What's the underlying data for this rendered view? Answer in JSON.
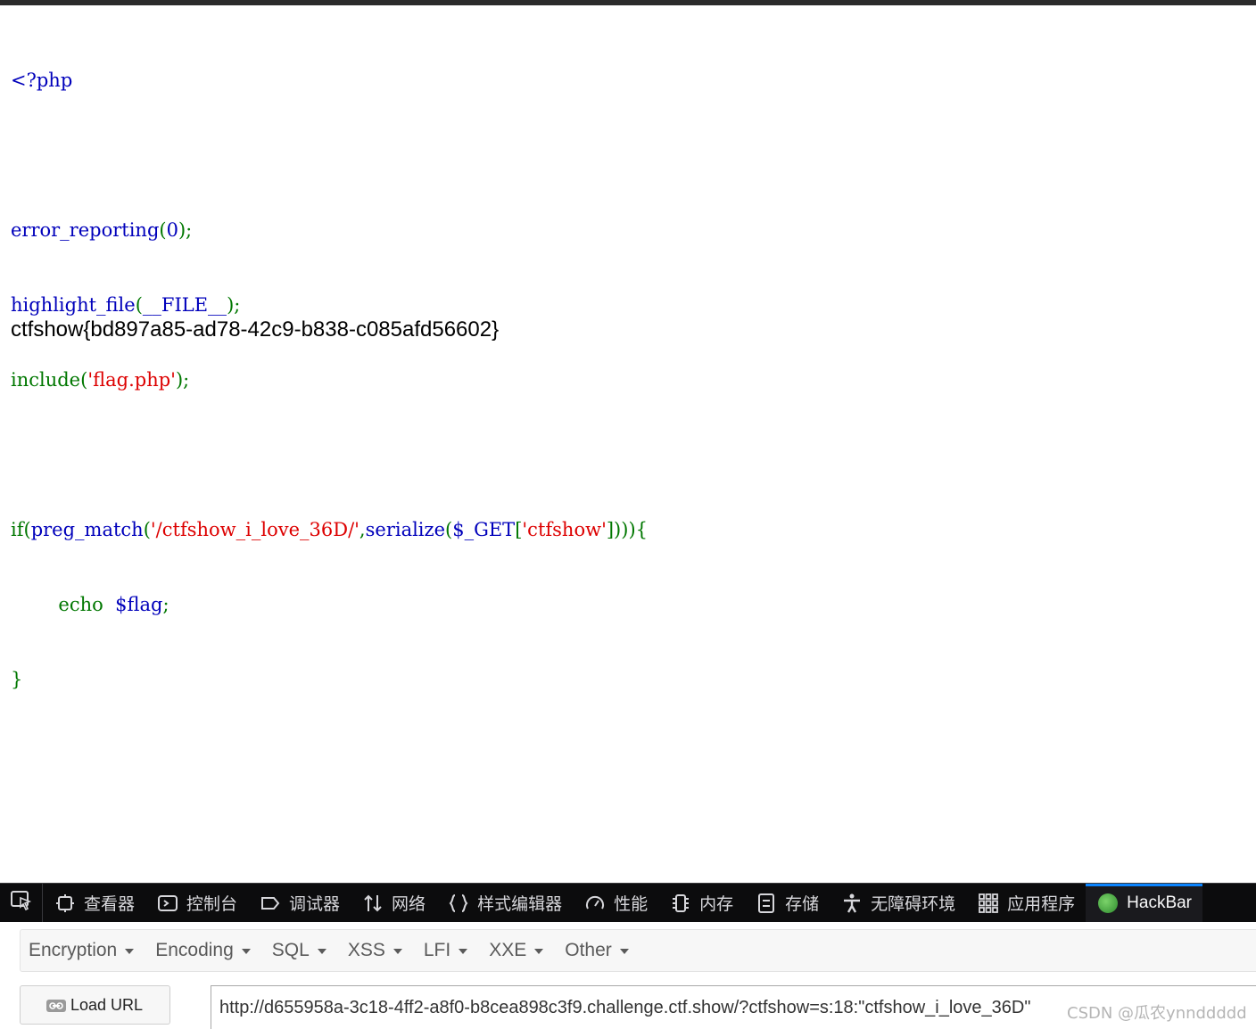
{
  "code": {
    "open_tag": "<?php",
    "l1_fn": "error_reporting",
    "l1_open": "(",
    "l1_arg": "0",
    "l1_close": ");",
    "l2_fn": "highlight_file",
    "l2_open": "(",
    "l2_arg": "__FILE__",
    "l2_close": ");",
    "l3_kw": "include",
    "l3_open": "(",
    "l3_str": "'flag.php'",
    "l3_close": ");",
    "l4_if": "if(",
    "l4_fn": "preg_match",
    "l4_open": "(",
    "l4_pattern": "'/ctfshow_i_love_36D/'",
    "l4_comma": ",",
    "l4_ser": "serialize",
    "l4_open2": "(",
    "l4_get": "$_GET",
    "l4_br": "[",
    "l4_key": "'ctfshow'",
    "l4_end": "]))){",
    "l5_echo": "echo",
    "l5_var": "$flag",
    "l5_semi": ";",
    "l6_close": "}"
  },
  "flag_output": "ctfshow{bd897a85-ad78-42c9-b838-c085afd56602}",
  "devtools": {
    "tabs": [
      {
        "label": "查看器",
        "icon": "inspector-icon"
      },
      {
        "label": "控制台",
        "icon": "console-icon"
      },
      {
        "label": "调试器",
        "icon": "debugger-icon"
      },
      {
        "label": "网络",
        "icon": "network-icon"
      },
      {
        "label": "样式编辑器",
        "icon": "style-editor-icon"
      },
      {
        "label": "性能",
        "icon": "performance-icon"
      },
      {
        "label": "内存",
        "icon": "memory-icon"
      },
      {
        "label": "存储",
        "icon": "storage-icon"
      },
      {
        "label": "无障碍环境",
        "icon": "accessibility-icon"
      },
      {
        "label": "应用程序",
        "icon": "application-icon"
      },
      {
        "label": "HackBar",
        "icon": "hackbar-logo-icon"
      }
    ],
    "active_tab": "HackBar",
    "accent": "#0a84ff"
  },
  "hackbar": {
    "menu": [
      "Encryption",
      "Encoding",
      "SQL",
      "XSS",
      "LFI",
      "XXE",
      "Other"
    ],
    "load_url_label": "Load URL",
    "url_value": "http://d655958a-3c18-4ff2-a8f0-b8cea898c3f9.challenge.ctf.show/?ctfshow=s:18:\"ctfshow_i_love_36D\""
  },
  "watermark": "CSDN @瓜农ynnddddd"
}
